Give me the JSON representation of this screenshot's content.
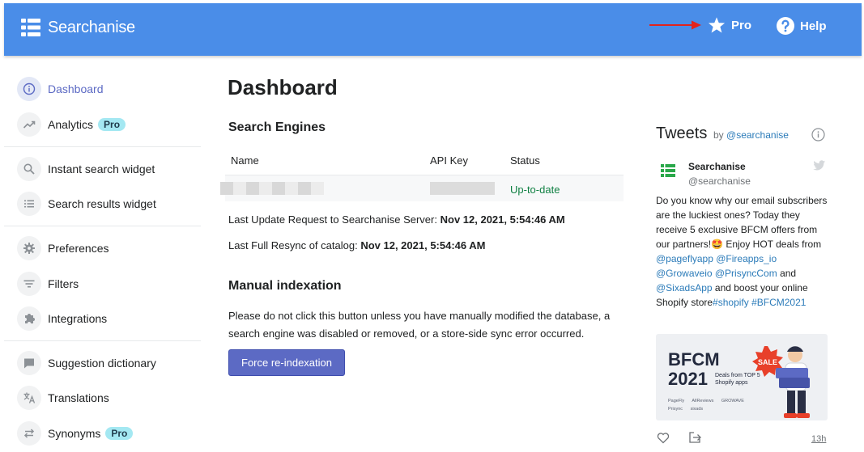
{
  "header": {
    "brand": "Searchanise",
    "pro_label": "Pro",
    "help_label": "Help",
    "bg_color": "#4a8de8"
  },
  "sidebar": {
    "items": [
      {
        "label": "Dashboard",
        "icon": "info-icon",
        "active": true
      },
      {
        "label": "Analytics",
        "icon": "trend-icon",
        "badge": "Pro"
      },
      {
        "label": "Instant search widget",
        "icon": "search-icon"
      },
      {
        "label": "Search results widget",
        "icon": "list-icon"
      },
      {
        "label": "Preferences",
        "icon": "gear-icon"
      },
      {
        "label": "Filters",
        "icon": "filter-icon"
      },
      {
        "label": "Integrations",
        "icon": "puzzle-icon"
      },
      {
        "label": "Suggestion dictionary",
        "icon": "chat-icon"
      },
      {
        "label": "Translations",
        "icon": "translate-icon"
      },
      {
        "label": "Synonyms",
        "icon": "swap-icon",
        "badge": "Pro"
      }
    ]
  },
  "main": {
    "title": "Dashboard",
    "search_engines": {
      "heading": "Search Engines",
      "columns": [
        "Name",
        "API Key",
        "Status"
      ],
      "rows": [
        {
          "status": "Up-to-date"
        }
      ]
    },
    "last_update_label": "Last Update Request to Searchanise Server:",
    "last_update_value": "Nov 12, 2021, 5:54:46 AM",
    "last_resync_label": "Last Full Resync of catalog:",
    "last_resync_value": "Nov 12, 2021, 5:54:46 AM",
    "manual": {
      "heading": "Manual indexation",
      "description": "Please do not click this button unless you have manually modified the database, a search engine was disabled or removed, or a store-side sync error occurred.",
      "button_label": "Force re-indexation"
    }
  },
  "tweets": {
    "title": "Tweets",
    "by": "by",
    "handle": "@searchanise",
    "tweet": {
      "author": "Searchanise",
      "author_handle": "@searchanise",
      "text_1": "Do you know why our email subscribers are the luckiest ones? Today they receive 5 exclusive BFCM offers from our partners!",
      "emoji": "🤩",
      "text_2": " Enjoy HOT deals from ",
      "mentions_1": "@pageflyapp @Fireapps_io @Growaveio @PrisyncCom",
      "text_3": " and ",
      "mentions_2": "@SixadsApp",
      "text_4": " and boost your online Shopify store",
      "hashtags": "#shopify #BFCM2021",
      "image_title_1": "BFCM",
      "image_title_2": "2021",
      "image_sub": "Deals from TOP 5 Shopify apps",
      "image_tag": "SALE",
      "image_brands": [
        "PageFly",
        "AllReviews",
        "GROWAVE",
        "Prisync",
        "sixads"
      ],
      "time": "13h"
    }
  }
}
